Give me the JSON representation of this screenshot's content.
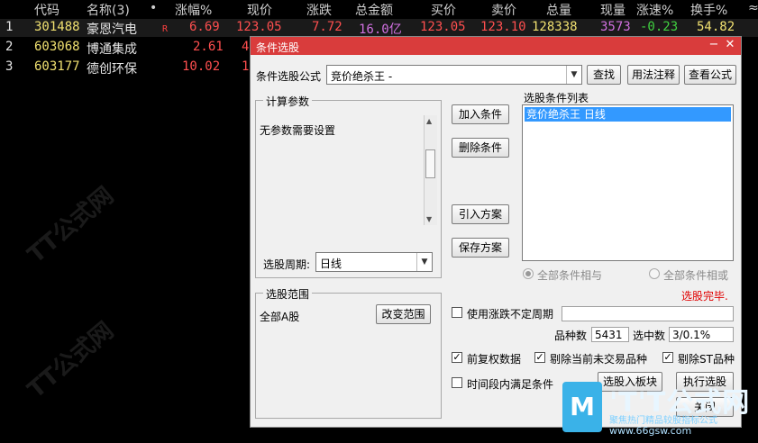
{
  "table": {
    "headers": [
      "代码",
      "名称(3)",
      "•",
      "涨幅%",
      "现价",
      "涨跌",
      "总金额",
      "买价",
      "卖价",
      "总量",
      "现量",
      "涨速%",
      "换手%",
      "≈"
    ],
    "rows": [
      {
        "idx": "1",
        "code": "301488",
        "name": "豪恩汽电",
        "flag": "R",
        "pct": "6.69",
        "price": "123.05",
        "chg": "7.72",
        "amount": "16.0亿",
        "bid": "123.05",
        "ask": "123.10",
        "vol": "128338",
        "cur": "3573",
        "speed": "-0.23",
        "turnover": "54.82"
      },
      {
        "idx": "2",
        "code": "603068",
        "name": "博通集成",
        "flag": "",
        "pct": "2.61",
        "price": "4",
        "chg": "",
        "amount": "",
        "bid": "",
        "ask": "",
        "vol": "",
        "cur": "",
        "speed": "",
        "turnover": ""
      },
      {
        "idx": "3",
        "code": "603177",
        "name": "德创环保",
        "flag": "",
        "pct": "10.02",
        "price": "1",
        "chg": "",
        "amount": "",
        "bid": "",
        "ask": "",
        "vol": "",
        "cur": "",
        "speed": "",
        "turnover": ""
      }
    ]
  },
  "dialog": {
    "title": "条件选股",
    "formula_label": "条件选股公式",
    "formula_value": "竞价绝杀王  -",
    "find_button": "查找",
    "usage_button": "用法注释",
    "view_formula_button": "查看公式",
    "calc_params_title": "计算参数",
    "no_params_text": "无参数需要设置",
    "period_label": "选股周期:",
    "period_value": "日线",
    "add_condition": "加入条件",
    "delete_condition": "删除条件",
    "import_scheme": "引入方案",
    "save_scheme": "保存方案",
    "condition_list_label": "选股条件列表",
    "conditions": [
      "竞价绝杀王  日线"
    ],
    "radio_and": "全部条件相与",
    "radio_or": "全部条件相或",
    "status_text": "选股完毕.",
    "range_title": "选股范围",
    "range_value": "全部A股",
    "change_range": "改变范围",
    "use_uncertain_period": "使用涨跌不定周期",
    "count_label": "品种数",
    "count_value": "5431",
    "selected_label": "选中数",
    "selected_value": "3/0.1%",
    "forward_adjust": "前复权数据",
    "exclude_untraded": "剔除当前未交易品种",
    "exclude_st": "剔除ST品种",
    "time_range_cond": "时间段内满足条件",
    "to_block_button": "选股入板块",
    "execute_button": "执行选股",
    "close_button": "关闭"
  },
  "brand": {
    "name": "'T'T公式网",
    "slogan": "聚焦热门精品较股指标公式",
    "url": "www.66gsw.com"
  }
}
